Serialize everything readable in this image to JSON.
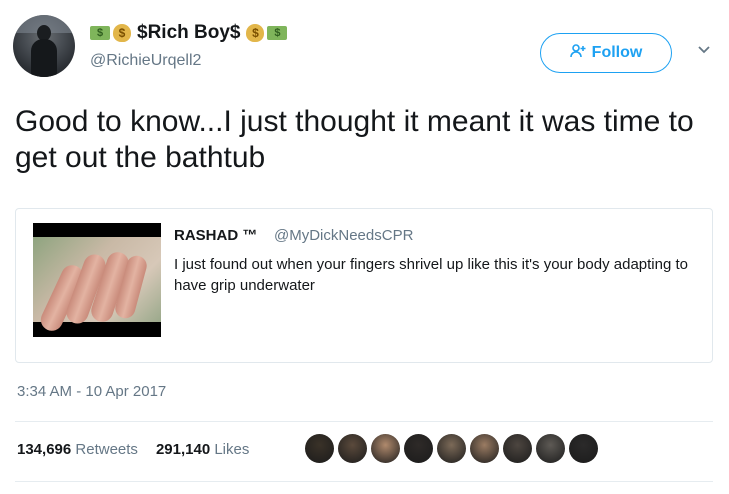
{
  "user": {
    "display_name": "$Rich Boy$",
    "handle": "@RichieUrqell2",
    "emoji_left": [
      "money-with-wings",
      "money-bag"
    ],
    "emoji_right": [
      "money-bag",
      "money-with-wings"
    ]
  },
  "follow": {
    "label": "Follow"
  },
  "tweet": {
    "text": "Good to know...I just thought it meant it was time to get out the bathtub",
    "timestamp": "3:34 AM - 10 Apr 2017"
  },
  "quote": {
    "name": "RASHAD ™",
    "handle": "@MyDickNeedsCPR",
    "text": "I just found out when your fingers shrivel up like this it's your body adapting to have grip underwater"
  },
  "stats": {
    "retweets_count": "134,696",
    "retweets_label": "Retweets",
    "likes_count": "291,140",
    "likes_label": "Likes"
  },
  "likers": [
    "#3a3228",
    "#5b4a3c",
    "#b08a6d",
    "#2e2a28",
    "#7c6a58",
    "#9b7c63",
    "#4d4640",
    "#5e5a55",
    "#2b2a2a"
  ],
  "colors": {
    "accent": "#1da1f2",
    "secondary_text": "#657786",
    "border": "#e1e8ed"
  }
}
